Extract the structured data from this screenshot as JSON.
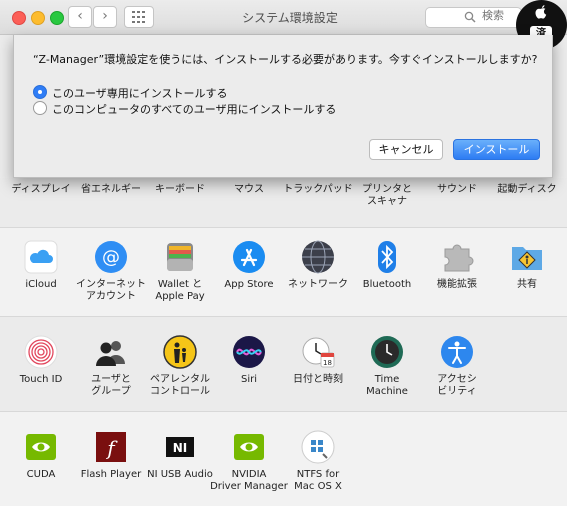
{
  "window": {
    "title": "システム環境設定",
    "search_placeholder": "検索"
  },
  "badge": {
    "seal_text": "済"
  },
  "dialog": {
    "message": "“Z-Manager”環境設定を使うには、インストールする必要があります。今すぐインストールしますか?",
    "options": [
      {
        "label": "このユーザ専用にインストールする",
        "selected": true
      },
      {
        "label": "このコンピュータのすべてのユーザ用にインストールする",
        "selected": false
      }
    ],
    "cancel_label": "キャンセル",
    "install_label": "インストール"
  },
  "rows": {
    "row1": [
      {
        "label": "ディスプレイ"
      },
      {
        "label": "省エネルギー"
      },
      {
        "label": "キーボード"
      },
      {
        "label": "マウス"
      },
      {
        "label": "トラックパッド"
      },
      {
        "label": "プリンタと\nスキャナ"
      },
      {
        "label": "サウンド"
      },
      {
        "label": "起動ディスク"
      }
    ],
    "row2": [
      {
        "label": "iCloud",
        "icon": "icloud-icon"
      },
      {
        "label": "インターネット\nアカウント",
        "icon": "at-icon"
      },
      {
        "label": "Wallet と\nApple Pay",
        "icon": "wallet-icon"
      },
      {
        "label": "App Store",
        "icon": "app-store-icon"
      },
      {
        "label": "ネットワーク",
        "icon": "network-globe-icon"
      },
      {
        "label": "Bluetooth",
        "icon": "bluetooth-icon"
      },
      {
        "label": "機能拡張",
        "icon": "puzzle-icon"
      },
      {
        "label": "共有",
        "icon": "sharing-folder-icon"
      }
    ],
    "row3": [
      {
        "label": "Touch ID",
        "icon": "fingerprint-icon"
      },
      {
        "label": "ユーザと\nグループ",
        "icon": "users-icon"
      },
      {
        "label": "ペアレンタル\nコントロール",
        "icon": "parental-icon"
      },
      {
        "label": "Siri",
        "icon": "siri-icon"
      },
      {
        "label": "日付と時刻",
        "icon": "clock-calendar-icon"
      },
      {
        "label": "Time\nMachine",
        "icon": "time-machine-icon"
      },
      {
        "label": "アクセシ\nビリティ",
        "icon": "accessibility-icon"
      }
    ],
    "row4": [
      {
        "label": "CUDA",
        "icon": "nvidia-icon"
      },
      {
        "label": "Flash Player",
        "icon": "flash-icon"
      },
      {
        "label": "NI USB Audio",
        "icon": "ni-icon"
      },
      {
        "label": "NVIDIA\nDriver Manager",
        "icon": "nvidia-icon"
      },
      {
        "label": "NTFS for\nMac OS X",
        "icon": "ntfs-icon"
      }
    ]
  },
  "colors": {
    "accent": "#2f7df6",
    "nvidia_green": "#76b900"
  }
}
